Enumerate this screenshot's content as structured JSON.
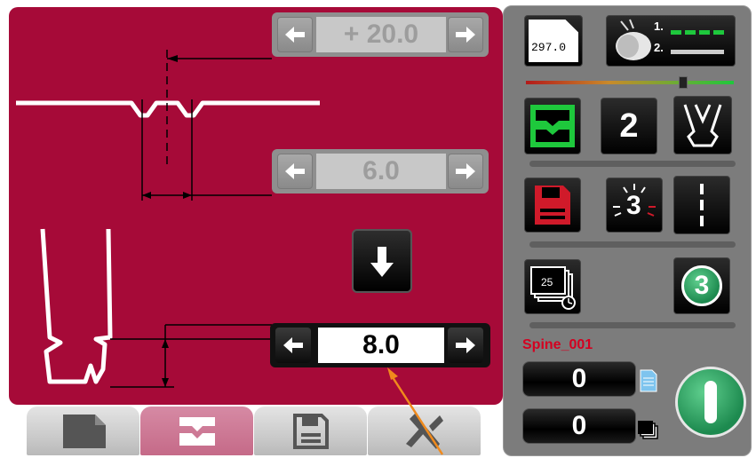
{
  "steppers": {
    "top_value": "+ 20.0",
    "middle_value": "6.0",
    "bottom_value": "8.0"
  },
  "right_panel": {
    "length_display": "297.0",
    "sequence_number": "2",
    "repetitions": "3",
    "bend_count": "3",
    "stack_count": "25",
    "program_name": "Spine_001",
    "counter_pieces": "0",
    "counter_stacks": "0",
    "encoder_labels": [
      "1.",
      "2."
    ]
  },
  "tabs": [
    {
      "name": "document",
      "selected": false
    },
    {
      "name": "bend",
      "selected": true
    },
    {
      "name": "save",
      "selected": false
    },
    {
      "name": "tools",
      "selected": false
    }
  ],
  "colors": {
    "panel_crimson": "#a60a38",
    "side_gray": "#7c7c7c",
    "active_green": "#1ec83c",
    "save_red": "#d01a2a",
    "annotation_orange": "#f08a1c"
  },
  "icons": {
    "left_arrow": "arrow-left-icon",
    "right_arrow": "arrow-right-icon",
    "down_arrow": "arrow-down-icon"
  }
}
